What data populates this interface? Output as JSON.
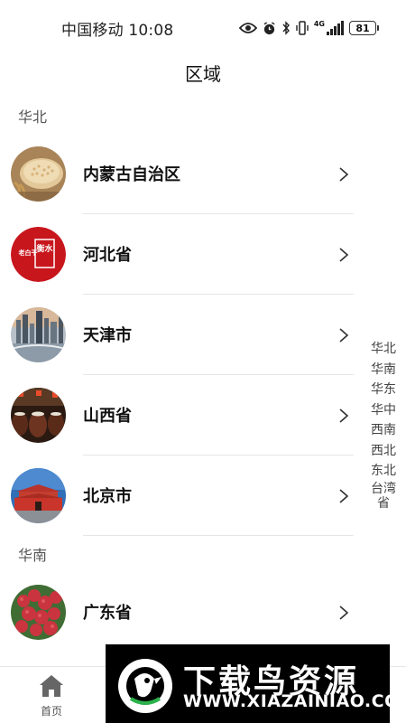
{
  "status_bar": {
    "carrier_time": "中国移动 10:08",
    "network": "4G",
    "battery": "81"
  },
  "header": {
    "title": "区域"
  },
  "sections": [
    {
      "header": "华北",
      "items": [
        {
          "label": "内蒙古自治区"
        },
        {
          "label": "河北省"
        },
        {
          "label": "天津市"
        },
        {
          "label": "山西省"
        },
        {
          "label": "北京市"
        }
      ]
    },
    {
      "header": "华南",
      "items": [
        {
          "label": "广东省"
        }
      ]
    }
  ],
  "index_bar": [
    "华北",
    "华南",
    "华东",
    "华中",
    "西南",
    "西北",
    "东北",
    "台湾省"
  ],
  "bottom_nav": {
    "home_label": "首页"
  },
  "thumbnail_badge": {
    "text_top": "衡水",
    "text_side": "老白干"
  },
  "watermark": {
    "title": "下载鸟资源",
    "url": "WWW.XIAZAINIAO.COM"
  },
  "colors": {
    "background": "#ffffff",
    "divider": "#e6e6e6",
    "text": "#111111",
    "watermark_bg": "#000000"
  }
}
